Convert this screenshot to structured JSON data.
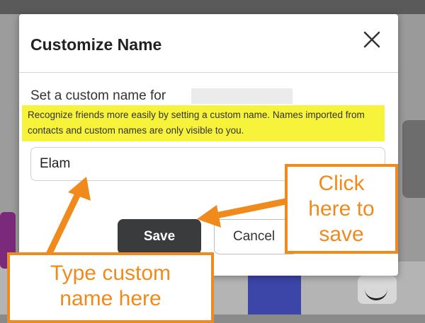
{
  "dialog": {
    "title": "Customize Name",
    "close_icon": "close-icon",
    "prompt": "Set a custom name for",
    "hint": "Recognize friends more easily by setting a custom name. Names imported from contacts and custom names are only visible to you.",
    "input_value": "Elam",
    "save_label": "Save",
    "cancel_label": "Cancel"
  },
  "annotations": {
    "save_callout": [
      "Click",
      "here to",
      "save"
    ],
    "type_callout": [
      "Type custom",
      "name here"
    ],
    "accent_color": "#f08a1c",
    "highlight_color": "#f7f23a"
  }
}
